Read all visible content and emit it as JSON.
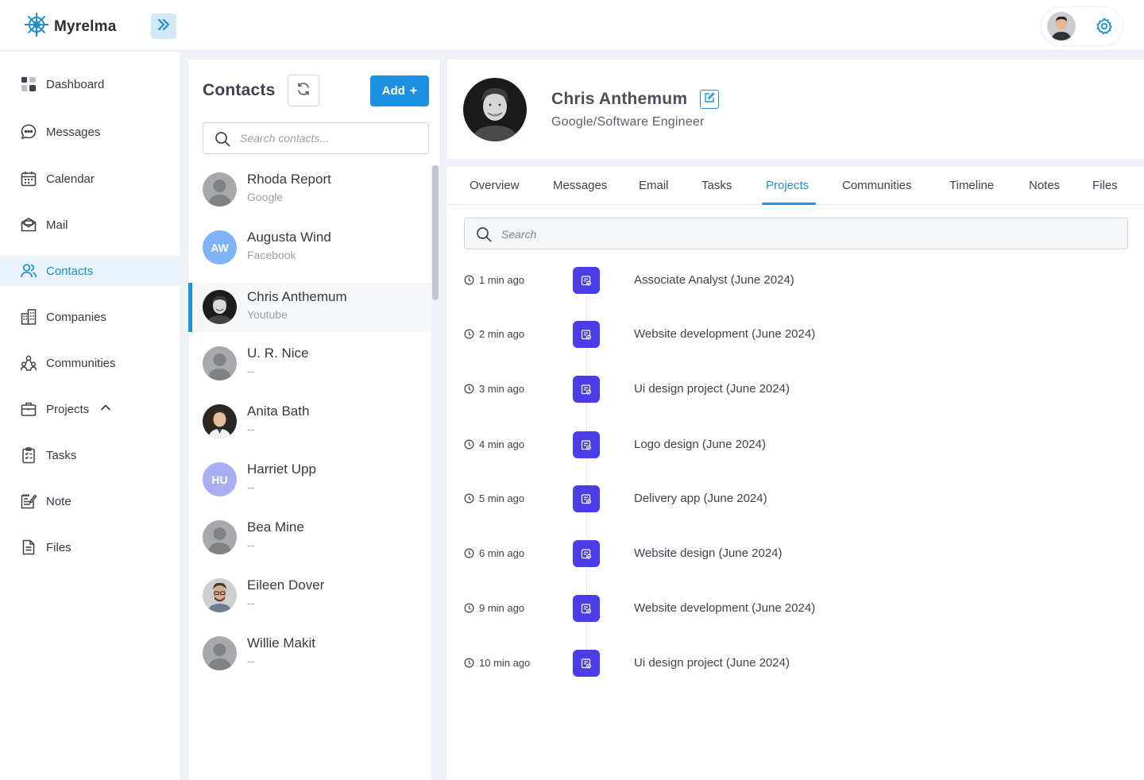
{
  "app": {
    "name": "Myrelma"
  },
  "colors": {
    "accent": "#1e90e0",
    "project_badge": "#4a3de8",
    "active_bg": "#e8f3fb"
  },
  "sidebar": {
    "items": [
      {
        "label": "Dashboard",
        "icon": "dashboard-icon"
      },
      {
        "label": "Messages",
        "icon": "chat-bubble-icon"
      },
      {
        "label": "Calendar",
        "icon": "calendar-icon"
      },
      {
        "label": "Mail",
        "icon": "mail-icon"
      },
      {
        "label": "Contacts",
        "icon": "contacts-icon",
        "active": true
      },
      {
        "label": "Companies",
        "icon": "building-icon"
      },
      {
        "label": "Communities",
        "icon": "community-icon"
      },
      {
        "label": "Projects",
        "icon": "briefcase-icon",
        "expanded": true
      },
      {
        "label": "Tasks",
        "icon": "clipboard-icon"
      },
      {
        "label": "Note",
        "icon": "note-icon"
      },
      {
        "label": "Files",
        "icon": "file-icon"
      }
    ]
  },
  "contacts": {
    "title": "Contacts",
    "add_label": "Add",
    "add_plus": "+",
    "search_placeholder": "Search contacts...",
    "list": [
      {
        "name": "Rhoda Report",
        "sub": "Google",
        "avatar": "placeholder"
      },
      {
        "name": "Augusta Wind",
        "sub": "Facebook",
        "avatar": "initials",
        "initials": "AW",
        "color": "#7fb3f5"
      },
      {
        "name": "Chris Anthemum",
        "sub": "Youtube",
        "avatar": "photo",
        "active": true
      },
      {
        "name": "U. R. Nice",
        "sub": "--",
        "avatar": "placeholder"
      },
      {
        "name": "Anita Bath",
        "sub": "--",
        "avatar": "photo"
      },
      {
        "name": "Harriet Upp",
        "sub": "--",
        "avatar": "initials",
        "initials": "HU",
        "color": "#a8aff0"
      },
      {
        "name": "Bea Mine",
        "sub": "--",
        "avatar": "placeholder"
      },
      {
        "name": "Eileen Dover",
        "sub": "--",
        "avatar": "photo"
      },
      {
        "name": "Willie Makit",
        "sub": "--",
        "avatar": "placeholder"
      }
    ]
  },
  "profile": {
    "name": "Chris Anthemum",
    "subtitle": "Google/Software Engineer"
  },
  "tabs": {
    "items": [
      "Overview",
      "Messages",
      "Email",
      "Tasks",
      "Projects",
      "Communities",
      "Timeline",
      "Notes",
      "Files"
    ],
    "active": "Projects"
  },
  "projects": {
    "search_placeholder": "Search",
    "items": [
      {
        "time": "1 min ago",
        "title": "Associate Analyst (June 2024)"
      },
      {
        "time": "2 min ago",
        "title": "Website development (June 2024)"
      },
      {
        "time": "3 min ago",
        "title": "Ui design project (June 2024)"
      },
      {
        "time": "4 min ago",
        "title": "Logo design (June 2024)"
      },
      {
        "time": "5 min ago",
        "title": "Delivery app (June 2024)"
      },
      {
        "time": "6 min ago",
        "title": "Website design (June 2024)"
      },
      {
        "time": "9 min ago",
        "title": "Website development (June 2024)"
      },
      {
        "time": "10 min ago",
        "title": "Ui design project (June 2024)"
      }
    ]
  }
}
